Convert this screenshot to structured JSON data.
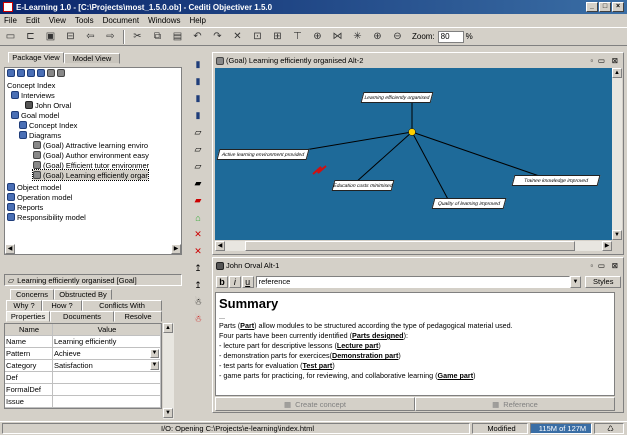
{
  "window": {
    "title": "E-Learning 1.0 - [C:\\Projects\\most_1.5.0.ob] - Cediti Objectiver 1.5.0"
  },
  "menu": [
    "File",
    "Edit",
    "View",
    "Tools",
    "Document",
    "Windows",
    "Help"
  ],
  "toolbar": {
    "zoom_label": "Zoom:",
    "zoom_value": "80",
    "zoom_unit": "%"
  },
  "left_tabs": [
    "Package View",
    "Model View"
  ],
  "tree": [
    {
      "label": "Concept Index",
      "icon": "none"
    },
    {
      "label": "Interviews",
      "icon": "book"
    },
    {
      "label": "John Orval",
      "icon": "person"
    },
    {
      "label": "Goal model",
      "icon": "book"
    },
    {
      "label": "Concept Index",
      "icon": "book"
    },
    {
      "label": "Diagrams",
      "icon": "book"
    },
    {
      "label": "(Goal) Attractive learning enviro",
      "icon": "goal"
    },
    {
      "label": "(Goal) Author environment easy",
      "icon": "goal"
    },
    {
      "label": "(Goal) Efficient tutor environmer",
      "icon": "goal"
    },
    {
      "label": "(Goal) Learning efficiently orgar",
      "icon": "goal"
    },
    {
      "label": "Object model",
      "icon": "book"
    },
    {
      "label": "Operation model",
      "icon": "book"
    },
    {
      "label": "Reports",
      "icon": "book"
    },
    {
      "label": "Responsibility model",
      "icon": "book"
    }
  ],
  "props": {
    "title": "Learning efficiently organised [Goal]",
    "tabs_row1": [
      "Concerns",
      "Obstructed By"
    ],
    "tabs_row2": [
      "Why ?",
      "How ?",
      "Conflicts With"
    ],
    "tabs_row3": [
      "Properties",
      "Documents",
      "Resolve"
    ],
    "headers": [
      "Name",
      "Value"
    ],
    "rows": [
      {
        "name": "Name",
        "value": "Learning efficiently"
      },
      {
        "name": "Pattern",
        "value": "Achieve"
      },
      {
        "name": "Category",
        "value": "Satisfaction"
      },
      {
        "name": "Def",
        "value": ""
      },
      {
        "name": "FormalDef",
        "value": ""
      },
      {
        "name": "Issue",
        "value": ""
      }
    ]
  },
  "diagram": {
    "title": "(Goal) Learning efficiently organised  Alt-2",
    "nodes": [
      "Learning efficiently organised",
      "Active learning environment provided",
      "Education costs minimised",
      "Trainee knowledge improved",
      "Quality of learning improved"
    ]
  },
  "interview": {
    "title": "John Orval  Alt-1",
    "reference_field": "reference",
    "styles_label": "Styles",
    "heading": "Summary",
    "ellipsis": "...",
    "lines": [
      {
        "pre": "Parts (",
        "bold": "Part",
        "post": ") allow modules to be structured according the type of pedagogical material used."
      },
      {
        "pre": "Four parts have been currently identified (",
        "bold": "Parts designed",
        "post": "):"
      },
      {
        "pre": "- lecture part for descriptive lessons (",
        "bold": "Lecture part",
        "post": ")"
      },
      {
        "pre": "- demonstration parts for exercices(",
        "bold": "Demonstration part",
        "post": ")"
      },
      {
        "pre": "- test parts for evaluation (",
        "bold": "Test part",
        "post": ")"
      },
      {
        "pre": "- game parts for practicing, for reviewing, and collaborative learning (",
        "bold": "Game part",
        "post": ")"
      }
    ],
    "create_concept": "Create concept",
    "reference": "Reference"
  },
  "status": {
    "message": "I/O: Opening C:\\Projects\\e-learning\\index.html",
    "state": "Modified",
    "memory": "115M of 127M"
  },
  "colors": {
    "diagram_bg": "#1e6a99",
    "titlebar": "#0a246a",
    "conflict": "#d01010"
  }
}
